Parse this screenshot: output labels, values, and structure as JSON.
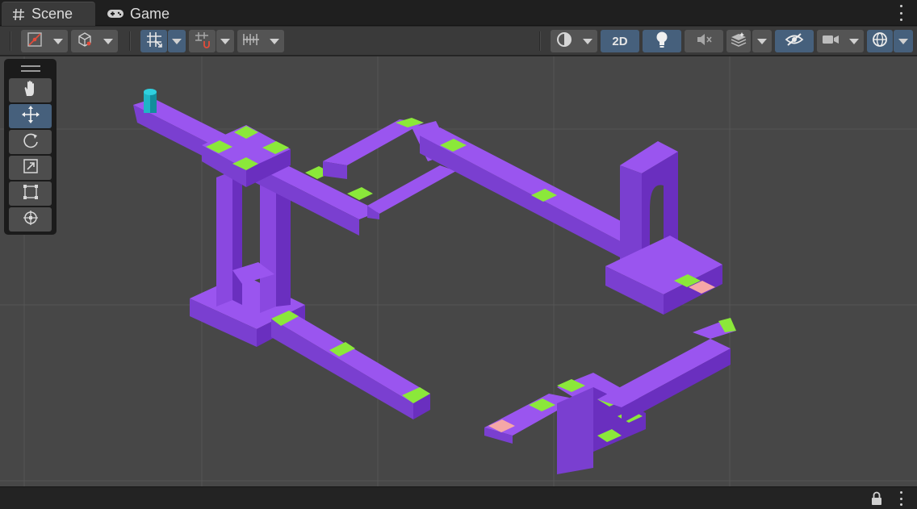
{
  "tabs": [
    {
      "label": "Scene",
      "icon": "hash-icon",
      "active": true
    },
    {
      "label": "Game",
      "icon": "gamepad-icon",
      "active": false
    }
  ],
  "toolbar": {
    "draw_mode_icon": "draw-mode-icon",
    "shading_icon": "shaded-cube-icon",
    "grid_snap_icon": "grid-snap-icon",
    "increment_snap_icon": "increment-snap-icon",
    "ruler_icon": "ruler-icon",
    "render_mode_icon": "sphere-shading-icon",
    "mode_2d_label": "2D",
    "lighting_icon": "light-bulb-icon",
    "audio_icon": "audio-mute-icon",
    "effects_icon": "effects-layers-icon",
    "hidden_objects_icon": "hidden-eye-icon",
    "camera_icon": "camera-icon",
    "gizmos_icon": "gizmos-globe-icon"
  },
  "tools": [
    {
      "name": "hand-tool",
      "icon": "hand-icon",
      "active": false
    },
    {
      "name": "move-tool",
      "icon": "move-arrows-icon",
      "active": true
    },
    {
      "name": "rotate-tool",
      "icon": "rotate-icon",
      "active": false
    },
    {
      "name": "scale-tool",
      "icon": "scale-icon",
      "active": false
    },
    {
      "name": "rect-tool",
      "icon": "rect-transform-icon",
      "active": false
    },
    {
      "name": "transform-tool",
      "icon": "transform-icon",
      "active": false
    }
  ],
  "colors": {
    "path_top": "#9a55ef",
    "path_left": "#7a3fd0",
    "path_right": "#6a2fbf",
    "highlight": "#8be83a",
    "target": "#f5a7a7",
    "player": "#1fb5c6",
    "grid": "#555555",
    "toolbar_active": "#46607c"
  },
  "status": {
    "lock_icon": "lock-icon",
    "menu_icon": "kebab-menu-icon"
  }
}
